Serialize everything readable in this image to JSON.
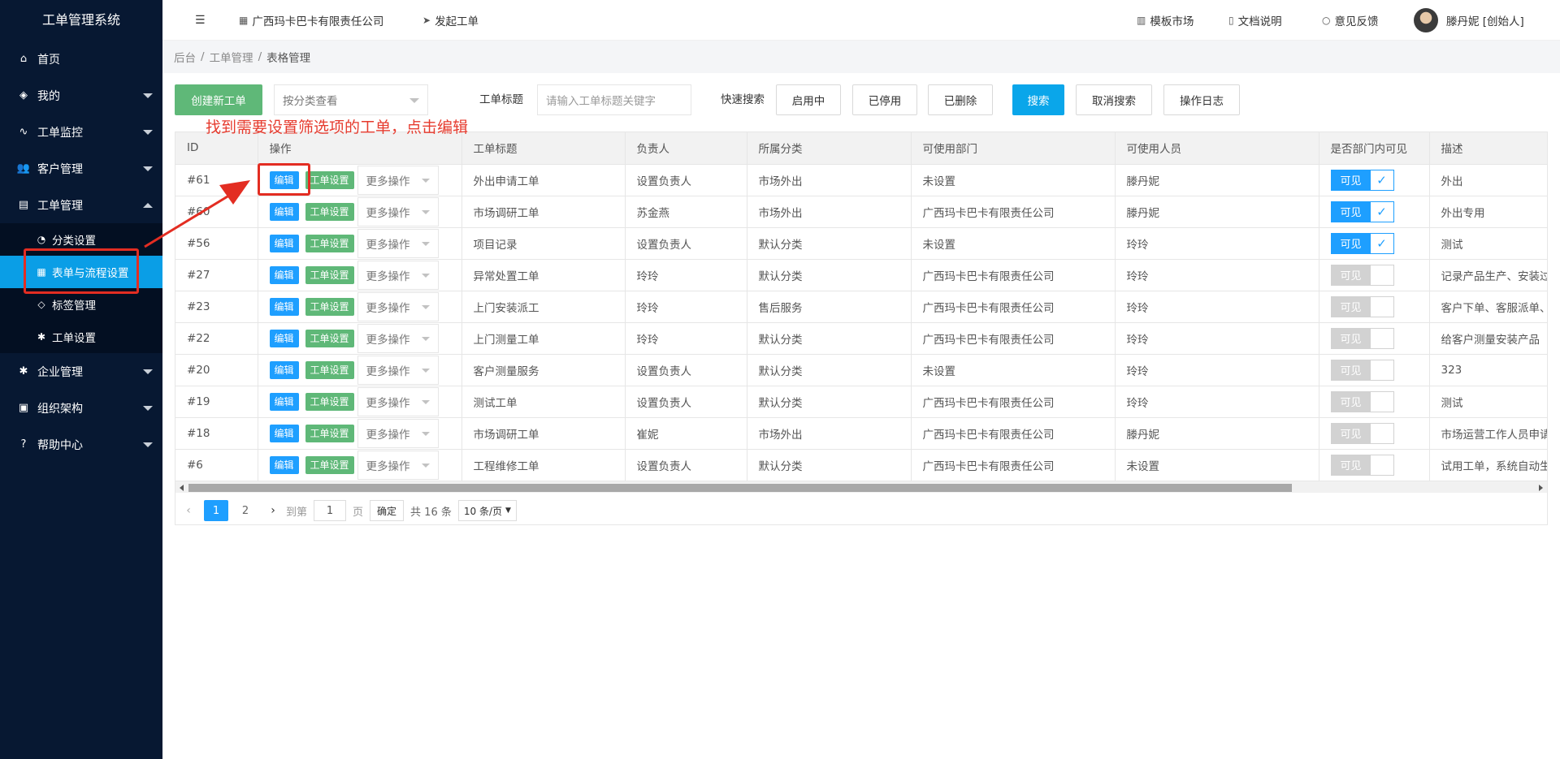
{
  "sidebar": {
    "title": "工单管理系统",
    "items": [
      {
        "label": "首页",
        "icon": "home-icon",
        "glyph": "⌂"
      },
      {
        "label": "我的",
        "icon": "layers-icon",
        "glyph": "◈"
      },
      {
        "label": "工单监控",
        "icon": "pulse-icon",
        "glyph": "∿"
      },
      {
        "label": "客户管理",
        "icon": "users-icon",
        "glyph": "👥"
      },
      {
        "label": "工单管理",
        "icon": "clipboard-icon",
        "glyph": "▤"
      }
    ],
    "sub_items": [
      {
        "label": "分类设置",
        "icon": "category-icon",
        "glyph": "◔"
      },
      {
        "label": "表单与流程设置",
        "icon": "grid-icon",
        "glyph": "▦"
      },
      {
        "label": "标签管理",
        "icon": "tag-icon",
        "glyph": "◇"
      },
      {
        "label": "工单设置",
        "icon": "gear-icon",
        "glyph": "✱"
      }
    ],
    "bottom_items": [
      {
        "label": "企业管理",
        "icon": "gear-icon",
        "glyph": "✱"
      },
      {
        "label": "组织架构",
        "icon": "org-icon",
        "glyph": "▣"
      },
      {
        "label": "帮助中心",
        "icon": "question-icon",
        "glyph": "?"
      }
    ]
  },
  "topbar": {
    "menu_toggle_glyph": "☰",
    "company": "广西玛卡巴卡有限责任公司",
    "start_ticket": "发起工单",
    "template_market": "模板市场",
    "docs": "文档说明",
    "feedback": "意见反馈",
    "user": "滕丹妮 [创始人]"
  },
  "breadcrumb": [
    "后台",
    "工单管理",
    "表格管理"
  ],
  "toolbar": {
    "create": "创建新工单",
    "category_select": "按分类查看",
    "title_label": "工单标题",
    "title_placeholder": "请输入工单标题关键字",
    "quick_search": "快速搜索",
    "enabled": "启用中",
    "disabled": "已停用",
    "deleted": "已删除",
    "search": "搜索",
    "cancel_search": "取消搜索",
    "log": "操作日志"
  },
  "table": {
    "headers": [
      "ID",
      "操作",
      "工单标题",
      "负责人",
      "所属分类",
      "可使用部门",
      "可使用人员",
      "是否部门内可见",
      "描述"
    ],
    "edit_label": "编辑",
    "settings_label": "工单设置",
    "more_label": "更多操作",
    "visible_label": "可见",
    "rows": [
      {
        "id": "#61",
        "title": "外出申请工单",
        "owner": "设置负责人",
        "category": "市场外出",
        "dept": "未设置",
        "people": "滕丹妮",
        "visible": true,
        "desc": "外出"
      },
      {
        "id": "#60",
        "title": "市场调研工单",
        "owner": "苏金燕",
        "category": "市场外出",
        "dept": "广西玛卡巴卡有限责任公司",
        "people": "滕丹妮",
        "visible": true,
        "desc": "外出专用"
      },
      {
        "id": "#56",
        "title": "项目记录",
        "owner": "设置负责人",
        "category": "默认分类",
        "dept": "未设置",
        "people": "玲玲",
        "visible": true,
        "desc": "测试"
      },
      {
        "id": "#27",
        "title": "异常处置工单",
        "owner": "玲玲",
        "category": "默认分类",
        "dept": "广西玛卡巴卡有限责任公司",
        "people": "玲玲",
        "visible": false,
        "desc": "记录产品生产、安装过"
      },
      {
        "id": "#23",
        "title": "上门安装派工",
        "owner": "玲玲",
        "category": "售后服务",
        "dept": "广西玛卡巴卡有限责任公司",
        "people": "玲玲",
        "visible": false,
        "desc": "客户下单、客服派单、"
      },
      {
        "id": "#22",
        "title": "上门测量工单",
        "owner": "玲玲",
        "category": "默认分类",
        "dept": "广西玛卡巴卡有限责任公司",
        "people": "玲玲",
        "visible": false,
        "desc": "给客户测量安装产品"
      },
      {
        "id": "#20",
        "title": "客户测量服务",
        "owner": "设置负责人",
        "category": "默认分类",
        "dept": "未设置",
        "people": "玲玲",
        "visible": false,
        "desc": "323"
      },
      {
        "id": "#19",
        "title": "测试工单",
        "owner": "设置负责人",
        "category": "默认分类",
        "dept": "广西玛卡巴卡有限责任公司",
        "people": "玲玲",
        "visible": false,
        "desc": "测试"
      },
      {
        "id": "#18",
        "title": "市场调研工单",
        "owner": "崔妮",
        "category": "市场外出",
        "dept": "广西玛卡巴卡有限责任公司",
        "people": "滕丹妮",
        "visible": false,
        "desc": "市场运营工作人员申请"
      },
      {
        "id": "#6",
        "title": "工程维修工单",
        "owner": "设置负责人",
        "category": "默认分类",
        "dept": "广西玛卡巴卡有限责任公司",
        "people": "未设置",
        "visible": false,
        "desc": "试用工单，系统自动生"
      }
    ]
  },
  "pager": {
    "pages": [
      "1",
      "2"
    ],
    "goto_label": "到第",
    "goto_value": "1",
    "page_unit": "页",
    "confirm": "确定",
    "total": "共 16 条",
    "page_size": "10 条/页"
  },
  "annotation": {
    "text": "找到需要设置筛选项的工单，点击编辑",
    "color": "#e63b2e"
  }
}
